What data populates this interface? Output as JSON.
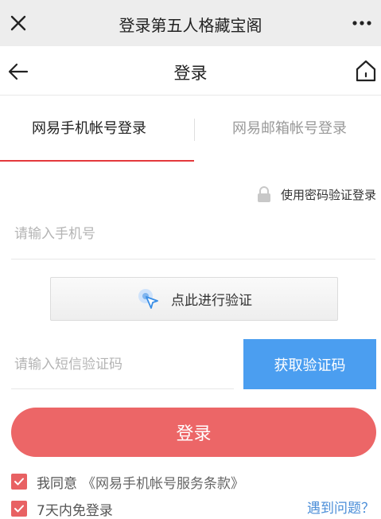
{
  "wechat_bar": {
    "title": "登录第五人格藏宝阁",
    "close_icon": "close-icon",
    "more_icon": "more-dots-icon"
  },
  "nav": {
    "title": "登录",
    "back_icon": "arrow-left-icon",
    "home_icon": "home-icon"
  },
  "tabs": [
    {
      "label": "网易手机帐号登录",
      "active": true
    },
    {
      "label": "网易邮箱帐号登录",
      "active": false
    }
  ],
  "password_login": {
    "label": "使用密码验证登录",
    "icon": "lock-icon"
  },
  "phone_field": {
    "placeholder": "请输入手机号",
    "value": ""
  },
  "verify": {
    "label": "点此进行验证",
    "icon": "cursor-click-icon"
  },
  "sms": {
    "placeholder": "请输入短信验证码",
    "value": "",
    "button_label": "获取验证码"
  },
  "login_button": "登录",
  "agreement": {
    "prefix": "我同意",
    "terms": "《网易手机帐号服务条款》",
    "checked": true
  },
  "remember": {
    "label": "7天内免登录",
    "checked": true
  },
  "help_link": "遇到问题？",
  "colors": {
    "accent_red": "#e4393c",
    "login_button": "#ec6667",
    "sms_button": "#4b9ef0",
    "link_blue": "#4b8ed8"
  }
}
